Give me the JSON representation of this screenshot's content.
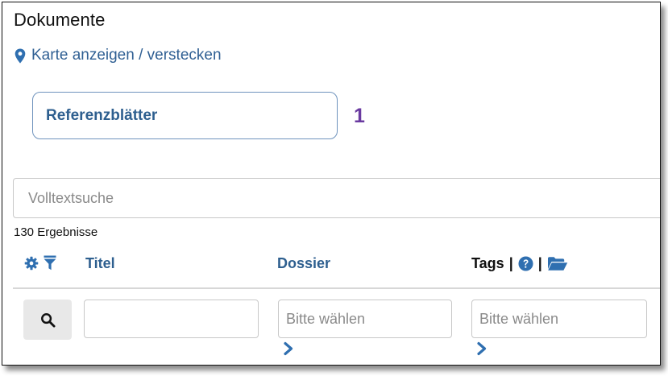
{
  "page": {
    "title": "Dokumente"
  },
  "map_toggle": {
    "label": "Karte anzeigen / verstecken",
    "icon": "map-pin-icon"
  },
  "reference_button": {
    "label": "Referenzblätter"
  },
  "callout": {
    "number": "1",
    "color": "#6a3aa0"
  },
  "search": {
    "placeholder": "Volltextsuche",
    "value": ""
  },
  "results": {
    "count_text": "130 Ergebnisse"
  },
  "table": {
    "header_icons": [
      "gear-icon",
      "filter-icon"
    ],
    "columns": {
      "title": "Titel",
      "dossier": "Dossier",
      "tags": "Tags"
    },
    "tags_icons": [
      "help-icon",
      "folder-open-icon"
    ],
    "separator": "|"
  },
  "filters": {
    "title_value": "",
    "dossier_placeholder": "Bitte wählen",
    "tags_placeholder": "Bitte wählen"
  },
  "colors": {
    "link": "#2e5f8f",
    "icon_blue": "#2f6fb0",
    "border": "#c8c8c8"
  }
}
